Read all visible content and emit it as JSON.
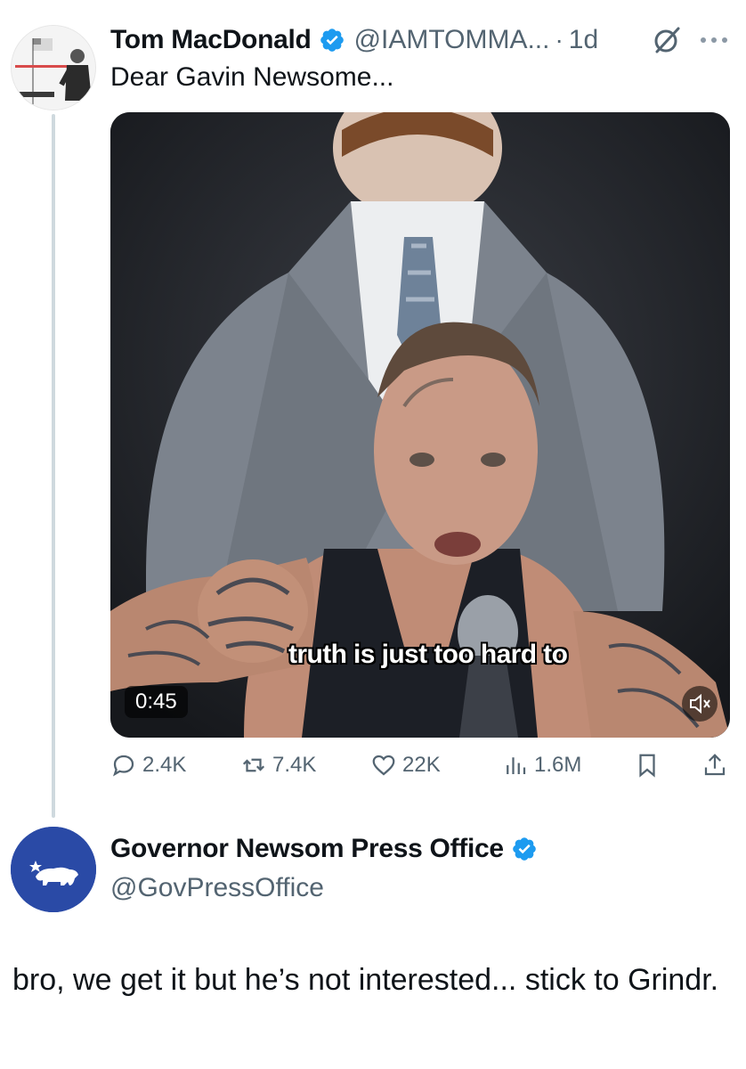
{
  "tweet": {
    "display_name": "Tom MacDonald",
    "handle": "@IAMTOMMA...",
    "separator": "·",
    "time": "1d",
    "text": "Dear Gavin Newsome...",
    "video": {
      "caption": "truth is just too hard to",
      "duration": "0:45"
    },
    "stats": {
      "replies": "2.4K",
      "reposts": "7.4K",
      "likes": "22K",
      "views": "1.6M"
    }
  },
  "reply": {
    "display_name": "Governor Newsom Press Office",
    "handle": "@GovPressOffice",
    "text": "bro, we get it but he’s not interested... stick to Grindr."
  },
  "colors": {
    "verified": "#1d9bf0",
    "secondary_text": "#536471",
    "thread_line": "#cfd9de",
    "gov_avatar_bg": "#2a4aa6"
  }
}
